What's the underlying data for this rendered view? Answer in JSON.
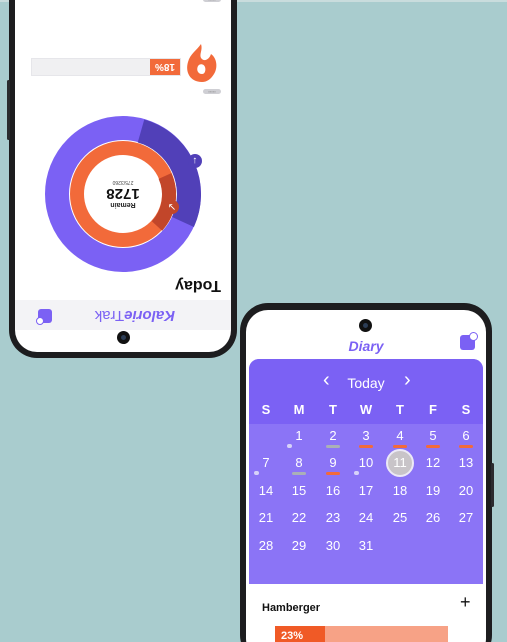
{
  "colors": {
    "background": "#a9ccce",
    "accent": "#7b61f4",
    "orange": "#f26a3a",
    "marker_gray": "#aab0b7"
  },
  "phone_top": {
    "app_logo_bold": "Kalorie",
    "app_logo_light": "Trak",
    "heading": "Today",
    "remain_label": "Remain",
    "remain_value": "1728",
    "remain_sub": "275/3260",
    "progress_percent": "18%",
    "progress_fraction": 0.18,
    "tag_label": "xxxxx",
    "icons": [
      "edit-note-icon",
      "arrow-down-icon",
      "arrow-diagonal-icon",
      "food-blob-icon"
    ]
  },
  "phone_bottom": {
    "app_title": "Diary",
    "calendar": {
      "prev_glyph": "‹",
      "title": "Today",
      "next_glyph": "›",
      "weekdays": [
        "S",
        "M",
        "T",
        "W",
        "T",
        "F",
        "S"
      ],
      "days": [
        "1",
        "2",
        "3",
        "4",
        "5",
        "6",
        "7",
        "8",
        "9",
        "10",
        "11",
        "12",
        "13",
        "14",
        "15",
        "16",
        "17",
        "18",
        "19",
        "20",
        "21",
        "22",
        "23",
        "24",
        "25",
        "26",
        "27",
        "28",
        "29",
        "30",
        "31"
      ],
      "selected_day": "11",
      "red_marked_days": [
        "3",
        "4",
        "5",
        "6",
        "9",
        "11"
      ],
      "gray_marked_days": [
        "2",
        "8"
      ],
      "dot_marked_days": [
        "1",
        "7",
        "10"
      ]
    },
    "food": {
      "name": "Hamberger",
      "add_glyph": "+",
      "percent_label": "23%",
      "percent_fraction": 0.23
    },
    "icons": [
      "edit-note-icon",
      "chevron-left-icon",
      "chevron-right-icon",
      "plus-icon"
    ]
  }
}
